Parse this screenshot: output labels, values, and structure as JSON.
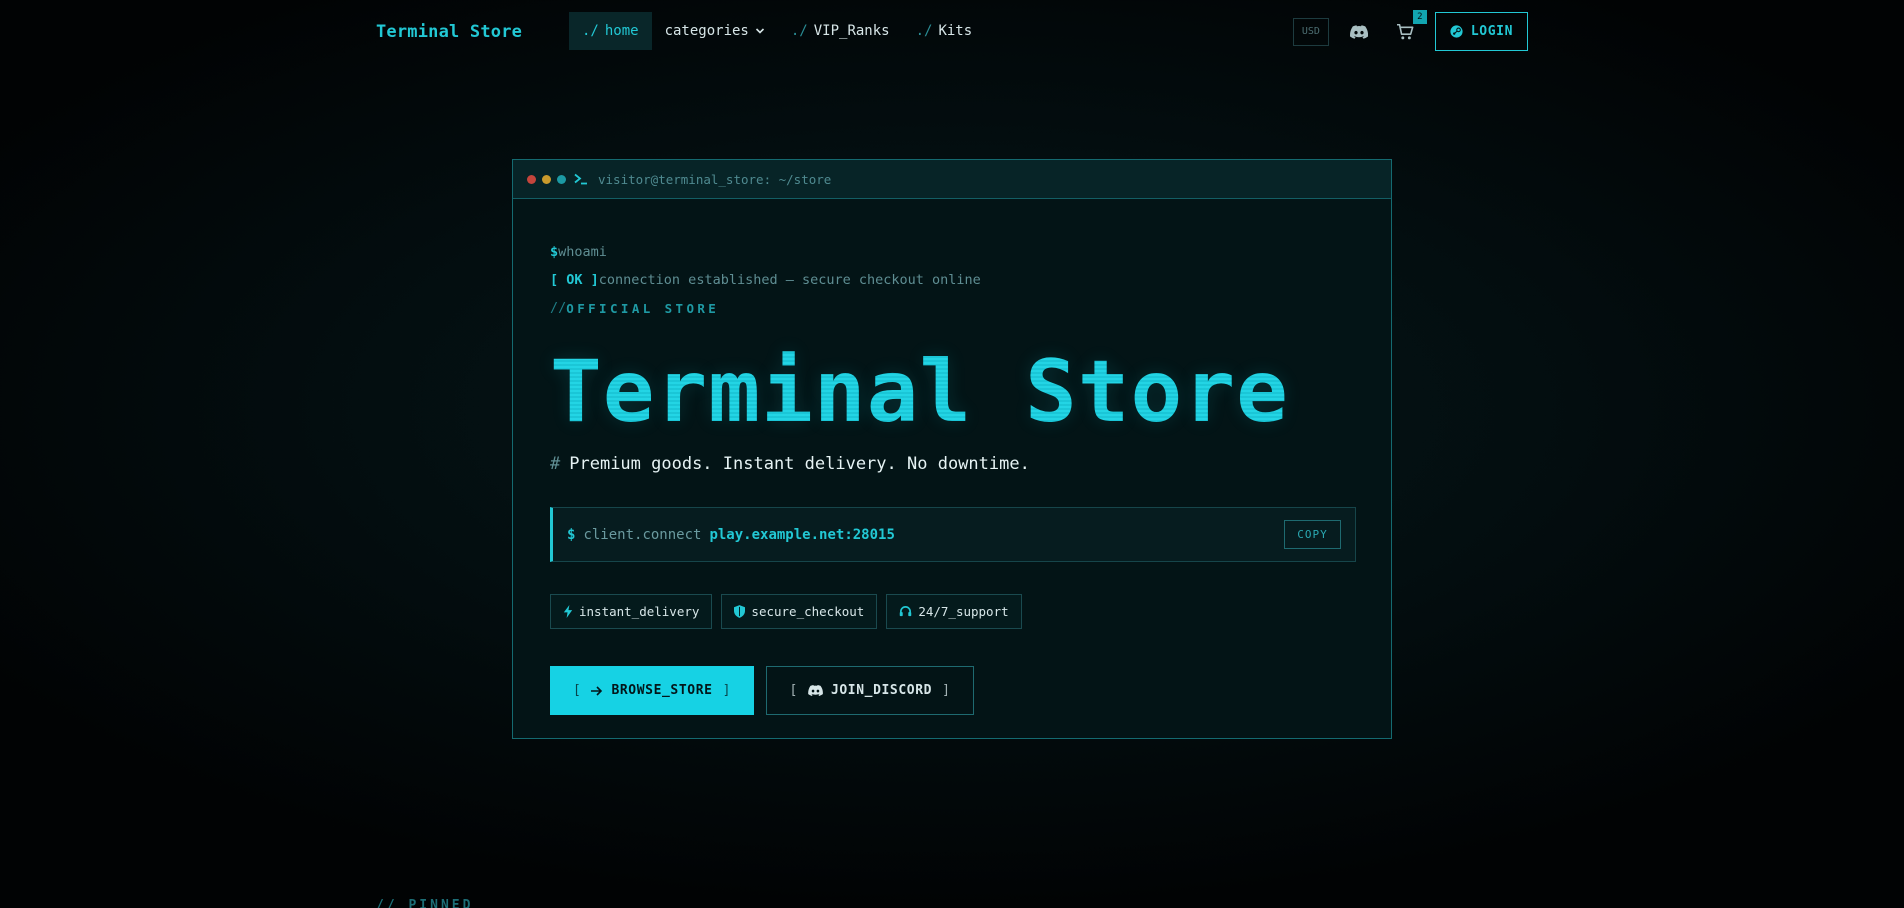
{
  "nav": {
    "brand": "Terminal Store",
    "links": [
      {
        "prefix": "./",
        "label": "home"
      },
      {
        "prefix": "",
        "label": "categories"
      },
      {
        "prefix": "./",
        "label": "VIP_Ranks"
      },
      {
        "prefix": "./",
        "label": "Kits"
      }
    ],
    "currency": "USD",
    "cart_count": "2",
    "login_label": "LOGIN"
  },
  "terminal": {
    "path": "visitor@terminal_store: ~/store",
    "line1_prompt": "$",
    "line1_cmd": "whoami",
    "line2_ok": "[ OK ]",
    "line2_text": "connection established — secure checkout online",
    "line3_slashes": "//",
    "line3_label": "OFFICIAL STORE",
    "title": "Terminal Store",
    "tagline_hash": "#",
    "tagline": "Premium goods. Instant delivery. No downtime.",
    "connect_prompt": "$",
    "connect_cmd": "client.connect",
    "connect_host": "play.example.net:28015",
    "copy_label": "COPY",
    "badges": [
      "instant_delivery",
      "secure_checkout",
      "24/7_support"
    ],
    "cta_primary": "BROWSE_STORE",
    "cta_secondary": "JOIN_DISCORD",
    "bracket_open": "[",
    "bracket_close": "]"
  },
  "bottom_peek": "// PINNED",
  "colors": {
    "accent": "#22c8d4",
    "background": "#030d0f",
    "panel": "#031416"
  }
}
